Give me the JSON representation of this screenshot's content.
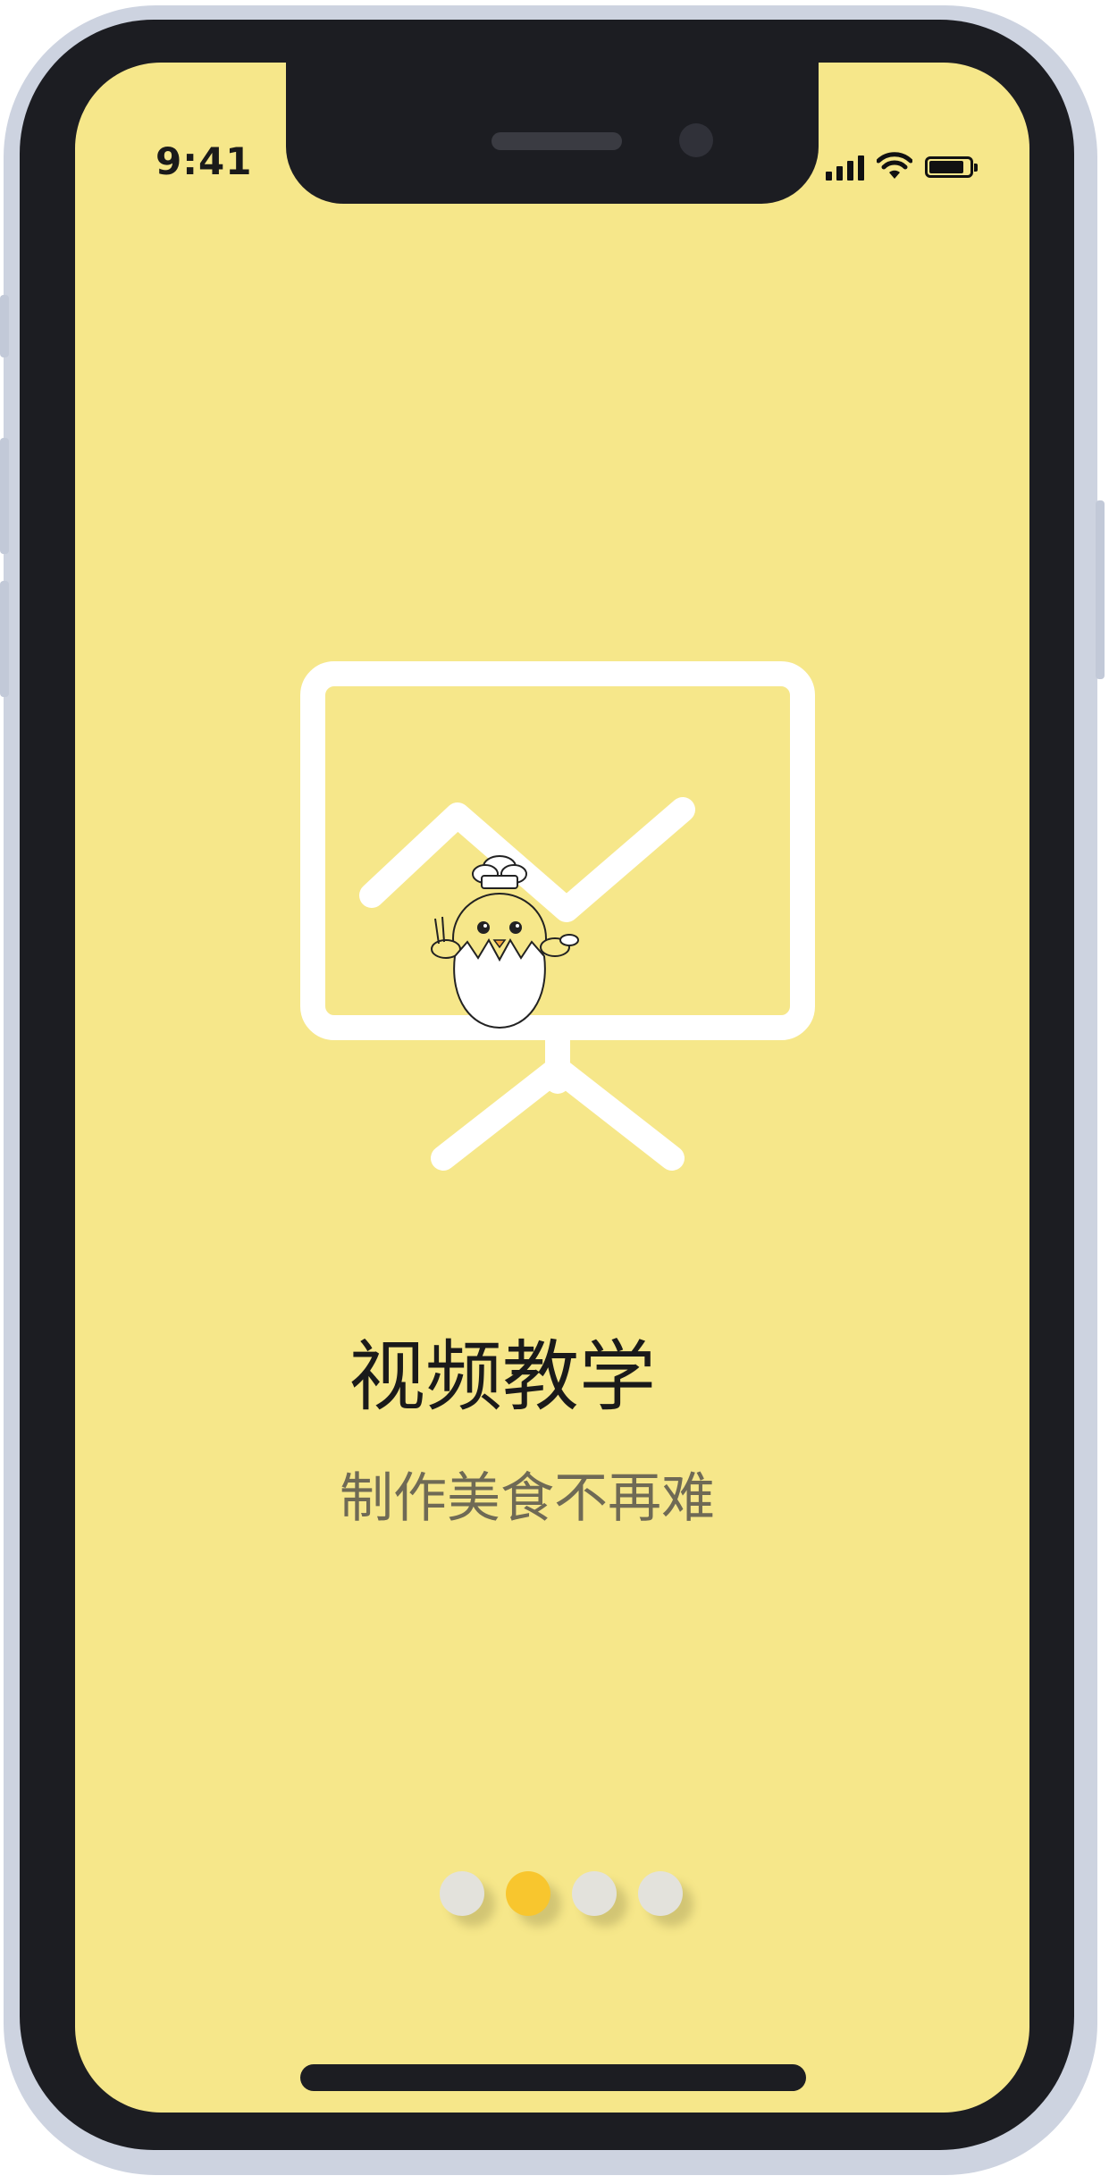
{
  "status_bar": {
    "time": "9:41",
    "signal_icon": "cellular-signal-icon",
    "wifi_icon": "wifi-icon",
    "battery_icon": "battery-icon"
  },
  "onboarding": {
    "hero_icon": "presentation-chart-icon",
    "mascot_image": "chick-chef-mascot",
    "title": "视频教学",
    "subtitle": "制作美食不再难"
  },
  "pager": {
    "total_pages": 4,
    "current_page": 2
  },
  "colors": {
    "screen_background": "#f6e78a",
    "active_dot": "#f8c62e",
    "inactive_dot": "#e3e2dc",
    "title_text": "#1a1a1a",
    "subtitle_text": "#6f6a55"
  }
}
